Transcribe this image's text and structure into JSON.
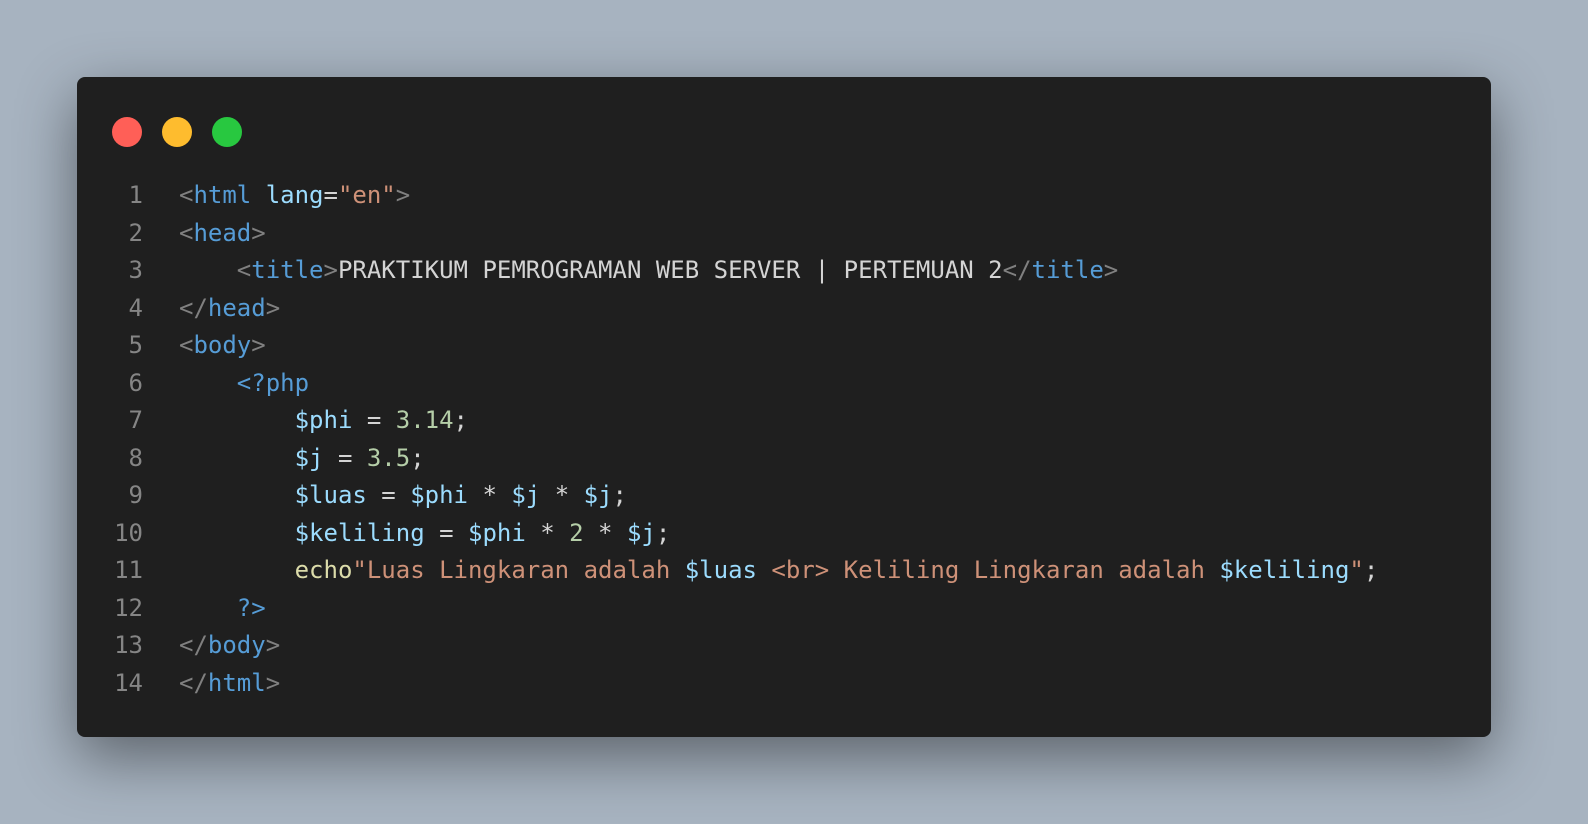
{
  "window": {
    "controls": [
      {
        "name": "close",
        "color": "#ff5f57"
      },
      {
        "name": "minimize",
        "color": "#febc2e"
      },
      {
        "name": "maximize",
        "color": "#28c840"
      }
    ]
  },
  "lines": [
    {
      "n": "1",
      "indent": "",
      "tokens": [
        {
          "t": "<",
          "c": "punct"
        },
        {
          "t": "html",
          "c": "tag"
        },
        {
          "t": " ",
          "c": "text"
        },
        {
          "t": "lang",
          "c": "attr"
        },
        {
          "t": "=",
          "c": "op"
        },
        {
          "t": "\"en\"",
          "c": "str"
        },
        {
          "t": ">",
          "c": "punct"
        }
      ]
    },
    {
      "n": "2",
      "indent": "",
      "tokens": [
        {
          "t": "<",
          "c": "punct"
        },
        {
          "t": "head",
          "c": "tag"
        },
        {
          "t": ">",
          "c": "punct"
        }
      ]
    },
    {
      "n": "3",
      "indent": "    ",
      "tokens": [
        {
          "t": "<",
          "c": "punct"
        },
        {
          "t": "title",
          "c": "tag"
        },
        {
          "t": ">",
          "c": "punct"
        },
        {
          "t": "PRAKTIKUM PEMROGRAMAN WEB SERVER | PERTEMUAN 2",
          "c": "text"
        },
        {
          "t": "</",
          "c": "punct"
        },
        {
          "t": "title",
          "c": "tag"
        },
        {
          "t": ">",
          "c": "punct"
        }
      ]
    },
    {
      "n": "4",
      "indent": "",
      "tokens": [
        {
          "t": "</",
          "c": "punct"
        },
        {
          "t": "head",
          "c": "tag"
        },
        {
          "t": ">",
          "c": "punct"
        }
      ]
    },
    {
      "n": "5",
      "indent": "",
      "tokens": [
        {
          "t": "<",
          "c": "punct"
        },
        {
          "t": "body",
          "c": "tag"
        },
        {
          "t": ">",
          "c": "punct"
        }
      ]
    },
    {
      "n": "6",
      "indent": "    ",
      "tokens": [
        {
          "t": "<?php",
          "c": "tag"
        }
      ]
    },
    {
      "n": "7",
      "indent": "        ",
      "tokens": [
        {
          "t": "$phi",
          "c": "var"
        },
        {
          "t": " = ",
          "c": "op"
        },
        {
          "t": "3.14",
          "c": "num"
        },
        {
          "t": ";",
          "c": "op"
        }
      ]
    },
    {
      "n": "8",
      "indent": "        ",
      "tokens": [
        {
          "t": "$j",
          "c": "var"
        },
        {
          "t": " = ",
          "c": "op"
        },
        {
          "t": "3.5",
          "c": "num"
        },
        {
          "t": ";",
          "c": "op"
        }
      ]
    },
    {
      "n": "9",
      "indent": "        ",
      "tokens": [
        {
          "t": "$luas",
          "c": "var"
        },
        {
          "t": " = ",
          "c": "op"
        },
        {
          "t": "$phi",
          "c": "var"
        },
        {
          "t": " * ",
          "c": "op"
        },
        {
          "t": "$j",
          "c": "var"
        },
        {
          "t": " * ",
          "c": "op"
        },
        {
          "t": "$j",
          "c": "var"
        },
        {
          "t": ";",
          "c": "op"
        }
      ]
    },
    {
      "n": "10",
      "indent": "        ",
      "tokens": [
        {
          "t": "$keliling",
          "c": "var"
        },
        {
          "t": " = ",
          "c": "op"
        },
        {
          "t": "$phi",
          "c": "var"
        },
        {
          "t": " * ",
          "c": "op"
        },
        {
          "t": "2",
          "c": "num"
        },
        {
          "t": " * ",
          "c": "op"
        },
        {
          "t": "$j",
          "c": "var"
        },
        {
          "t": ";",
          "c": "op"
        }
      ]
    },
    {
      "n": "11",
      "indent": "        ",
      "tokens": [
        {
          "t": "echo",
          "c": "fn"
        },
        {
          "t": "\"Luas Lingkaran adalah ",
          "c": "str"
        },
        {
          "t": "$luas",
          "c": "var"
        },
        {
          "t": " <br> Keliling Lingkaran adalah ",
          "c": "str"
        },
        {
          "t": "$keliling",
          "c": "var"
        },
        {
          "t": "\"",
          "c": "str"
        },
        {
          "t": ";",
          "c": "op"
        }
      ]
    },
    {
      "n": "12",
      "indent": "    ",
      "tokens": [
        {
          "t": "?>",
          "c": "tag"
        }
      ]
    },
    {
      "n": "13",
      "indent": "",
      "tokens": [
        {
          "t": "</",
          "c": "punct"
        },
        {
          "t": "body",
          "c": "tag"
        },
        {
          "t": ">",
          "c": "punct"
        }
      ]
    },
    {
      "n": "14",
      "indent": "",
      "tokens": [
        {
          "t": "</",
          "c": "punct"
        },
        {
          "t": "html",
          "c": "tag"
        },
        {
          "t": ">",
          "c": "punct"
        }
      ]
    }
  ]
}
